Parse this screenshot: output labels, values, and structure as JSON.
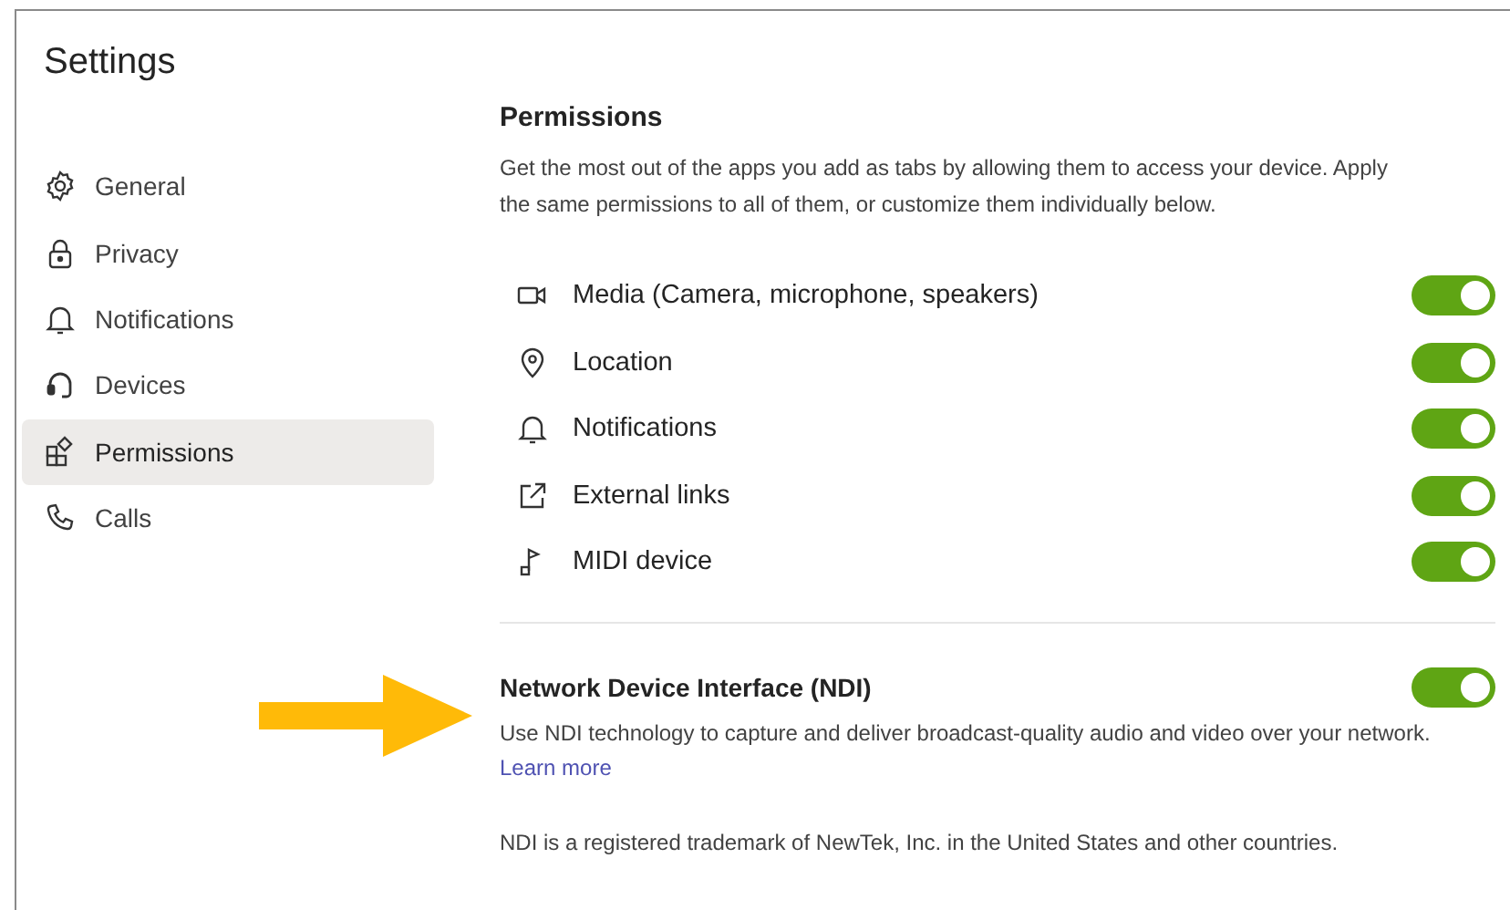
{
  "window": {
    "title": "Settings"
  },
  "sidebar": {
    "items": [
      {
        "label": "General",
        "selected": false
      },
      {
        "label": "Privacy",
        "selected": false
      },
      {
        "label": "Notifications",
        "selected": false
      },
      {
        "label": "Devices",
        "selected": false
      },
      {
        "label": "Permissions",
        "selected": true
      },
      {
        "label": "Calls",
        "selected": false
      }
    ]
  },
  "permissions": {
    "title": "Permissions",
    "description": "Get the most out of the apps you add as tabs by allowing them to access your device. Apply the same permissions to all of them, or customize them individually below.",
    "items": [
      {
        "label": "Media (Camera, microphone, speakers)",
        "on": true
      },
      {
        "label": "Location",
        "on": true
      },
      {
        "label": "Notifications",
        "on": true
      },
      {
        "label": "External links",
        "on": true
      },
      {
        "label": "MIDI device",
        "on": true
      }
    ]
  },
  "ndi": {
    "title": "Network Device Interface (NDI)",
    "on": true,
    "description": "Use NDI technology to capture and deliver broadcast-quality audio and video over your network.",
    "link": "Learn more",
    "note": "NDI is a registered trademark of NewTek, Inc. in the United States and other countries."
  }
}
